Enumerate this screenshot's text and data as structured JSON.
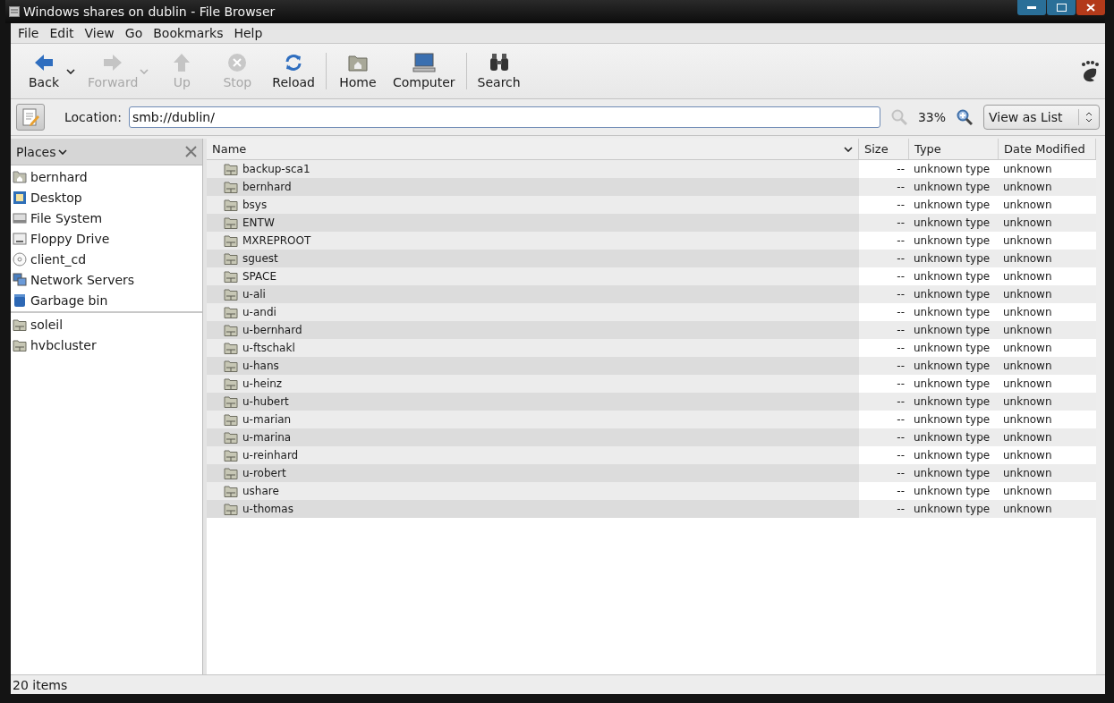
{
  "window": {
    "title": "Windows shares on dublin - File Browser"
  },
  "menu": [
    "File",
    "Edit",
    "View",
    "Go",
    "Bookmarks",
    "Help"
  ],
  "toolbar": [
    {
      "kind": "back",
      "label": "Back",
      "disabled": false,
      "dropdown": true
    },
    {
      "kind": "forward",
      "label": "Forward",
      "disabled": true,
      "dropdown": true
    },
    {
      "kind": "up",
      "label": "Up",
      "disabled": true,
      "dropdown": false
    },
    {
      "kind": "stop",
      "label": "Stop",
      "disabled": true,
      "dropdown": false
    },
    {
      "kind": "reload",
      "label": "Reload",
      "disabled": false,
      "dropdown": false
    },
    {
      "kind": "separator"
    },
    {
      "kind": "home",
      "label": "Home",
      "disabled": false,
      "dropdown": false
    },
    {
      "kind": "computer",
      "label": "Computer",
      "disabled": false,
      "dropdown": false
    },
    {
      "kind": "separator"
    },
    {
      "kind": "search",
      "label": "Search",
      "disabled": false,
      "dropdown": false
    }
  ],
  "location": {
    "label": "Location:",
    "value": "smb://dublin/",
    "zoom": "33%",
    "view": "View as List"
  },
  "sidebar": {
    "title": "Places",
    "sections": [
      [
        {
          "kind": "home",
          "label": "bernhard"
        },
        {
          "kind": "desktop",
          "label": "Desktop"
        },
        {
          "kind": "drive",
          "label": "File System"
        },
        {
          "kind": "floppy",
          "label": "Floppy Drive"
        },
        {
          "kind": "cd",
          "label": "client_cd"
        },
        {
          "kind": "network",
          "label": "Network Servers"
        },
        {
          "kind": "trash",
          "label": "Garbage bin"
        }
      ],
      [
        {
          "kind": "folder",
          "label": "soleil"
        },
        {
          "kind": "folder",
          "label": "hvbcluster"
        }
      ]
    ]
  },
  "table": {
    "columns": [
      {
        "label": "Name",
        "sorted": true
      },
      {
        "label": "Size",
        "sorted": false
      },
      {
        "label": "Type",
        "sorted": false
      },
      {
        "label": "Date Modified",
        "sorted": false
      }
    ],
    "rows": [
      [
        "backup-sca1",
        "--",
        "unknown type",
        "unknown"
      ],
      [
        "bernhard",
        "--",
        "unknown type",
        "unknown"
      ],
      [
        "bsys",
        "--",
        "unknown type",
        "unknown"
      ],
      [
        "ENTW",
        "--",
        "unknown type",
        "unknown"
      ],
      [
        "MXREPROOT",
        "--",
        "unknown type",
        "unknown"
      ],
      [
        "sguest",
        "--",
        "unknown type",
        "unknown"
      ],
      [
        "SPACE",
        "--",
        "unknown type",
        "unknown"
      ],
      [
        "u-ali",
        "--",
        "unknown type",
        "unknown"
      ],
      [
        "u-andi",
        "--",
        "unknown type",
        "unknown"
      ],
      [
        "u-bernhard",
        "--",
        "unknown type",
        "unknown"
      ],
      [
        "u-ftschakl",
        "--",
        "unknown type",
        "unknown"
      ],
      [
        "u-hans",
        "--",
        "unknown type",
        "unknown"
      ],
      [
        "u-heinz",
        "--",
        "unknown type",
        "unknown"
      ],
      [
        "u-hubert",
        "--",
        "unknown type",
        "unknown"
      ],
      [
        "u-marian",
        "--",
        "unknown type",
        "unknown"
      ],
      [
        "u-marina",
        "--",
        "unknown type",
        "unknown"
      ],
      [
        "u-reinhard",
        "--",
        "unknown type",
        "unknown"
      ],
      [
        "u-robert",
        "--",
        "unknown type",
        "unknown"
      ],
      [
        "ushare",
        "--",
        "unknown type",
        "unknown"
      ],
      [
        "u-thomas",
        "--",
        "unknown type",
        "unknown"
      ]
    ]
  },
  "status_bar": "20 items"
}
